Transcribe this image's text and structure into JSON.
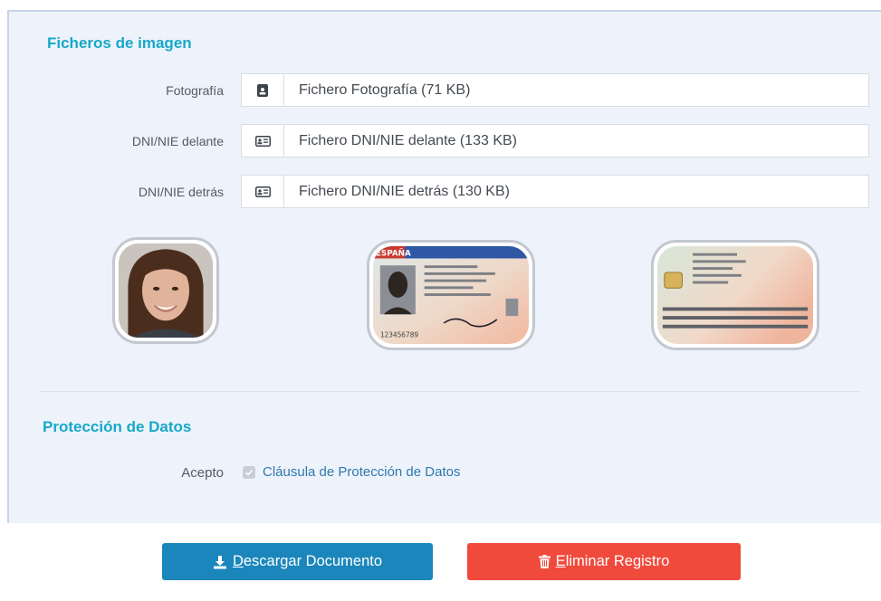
{
  "images_section": {
    "title": "Ficheros de imagen",
    "rows": [
      {
        "label": "Fotografía",
        "icon": "id-badge-icon",
        "value": "Fichero Fotografía (71 KB)"
      },
      {
        "label": "DNI/NIE delante",
        "icon": "id-card-icon",
        "value": "Fichero DNI/NIE delante (133 KB)"
      },
      {
        "label": "DNI/NIE detrás",
        "icon": "id-card-icon",
        "value": "Fichero DNI/NIE detrás (130 KB)"
      }
    ],
    "thumbnails": [
      {
        "kind": "photo"
      },
      {
        "kind": "dni-front",
        "header": "ESPAÑA",
        "number": "123456789"
      },
      {
        "kind": "dni-back"
      }
    ]
  },
  "data_protection": {
    "title": "Protección de Datos",
    "accept_label": "Acepto",
    "checked": true,
    "clause_link": "Cláusula de Protección de Datos"
  },
  "actions": {
    "download_label": "Descargar Documento",
    "delete_label": "Eliminar Registro"
  },
  "colors": {
    "accent": "#17a8c8",
    "download": "#1b86bb",
    "delete": "#f04a3d",
    "link": "#2f78ad"
  }
}
